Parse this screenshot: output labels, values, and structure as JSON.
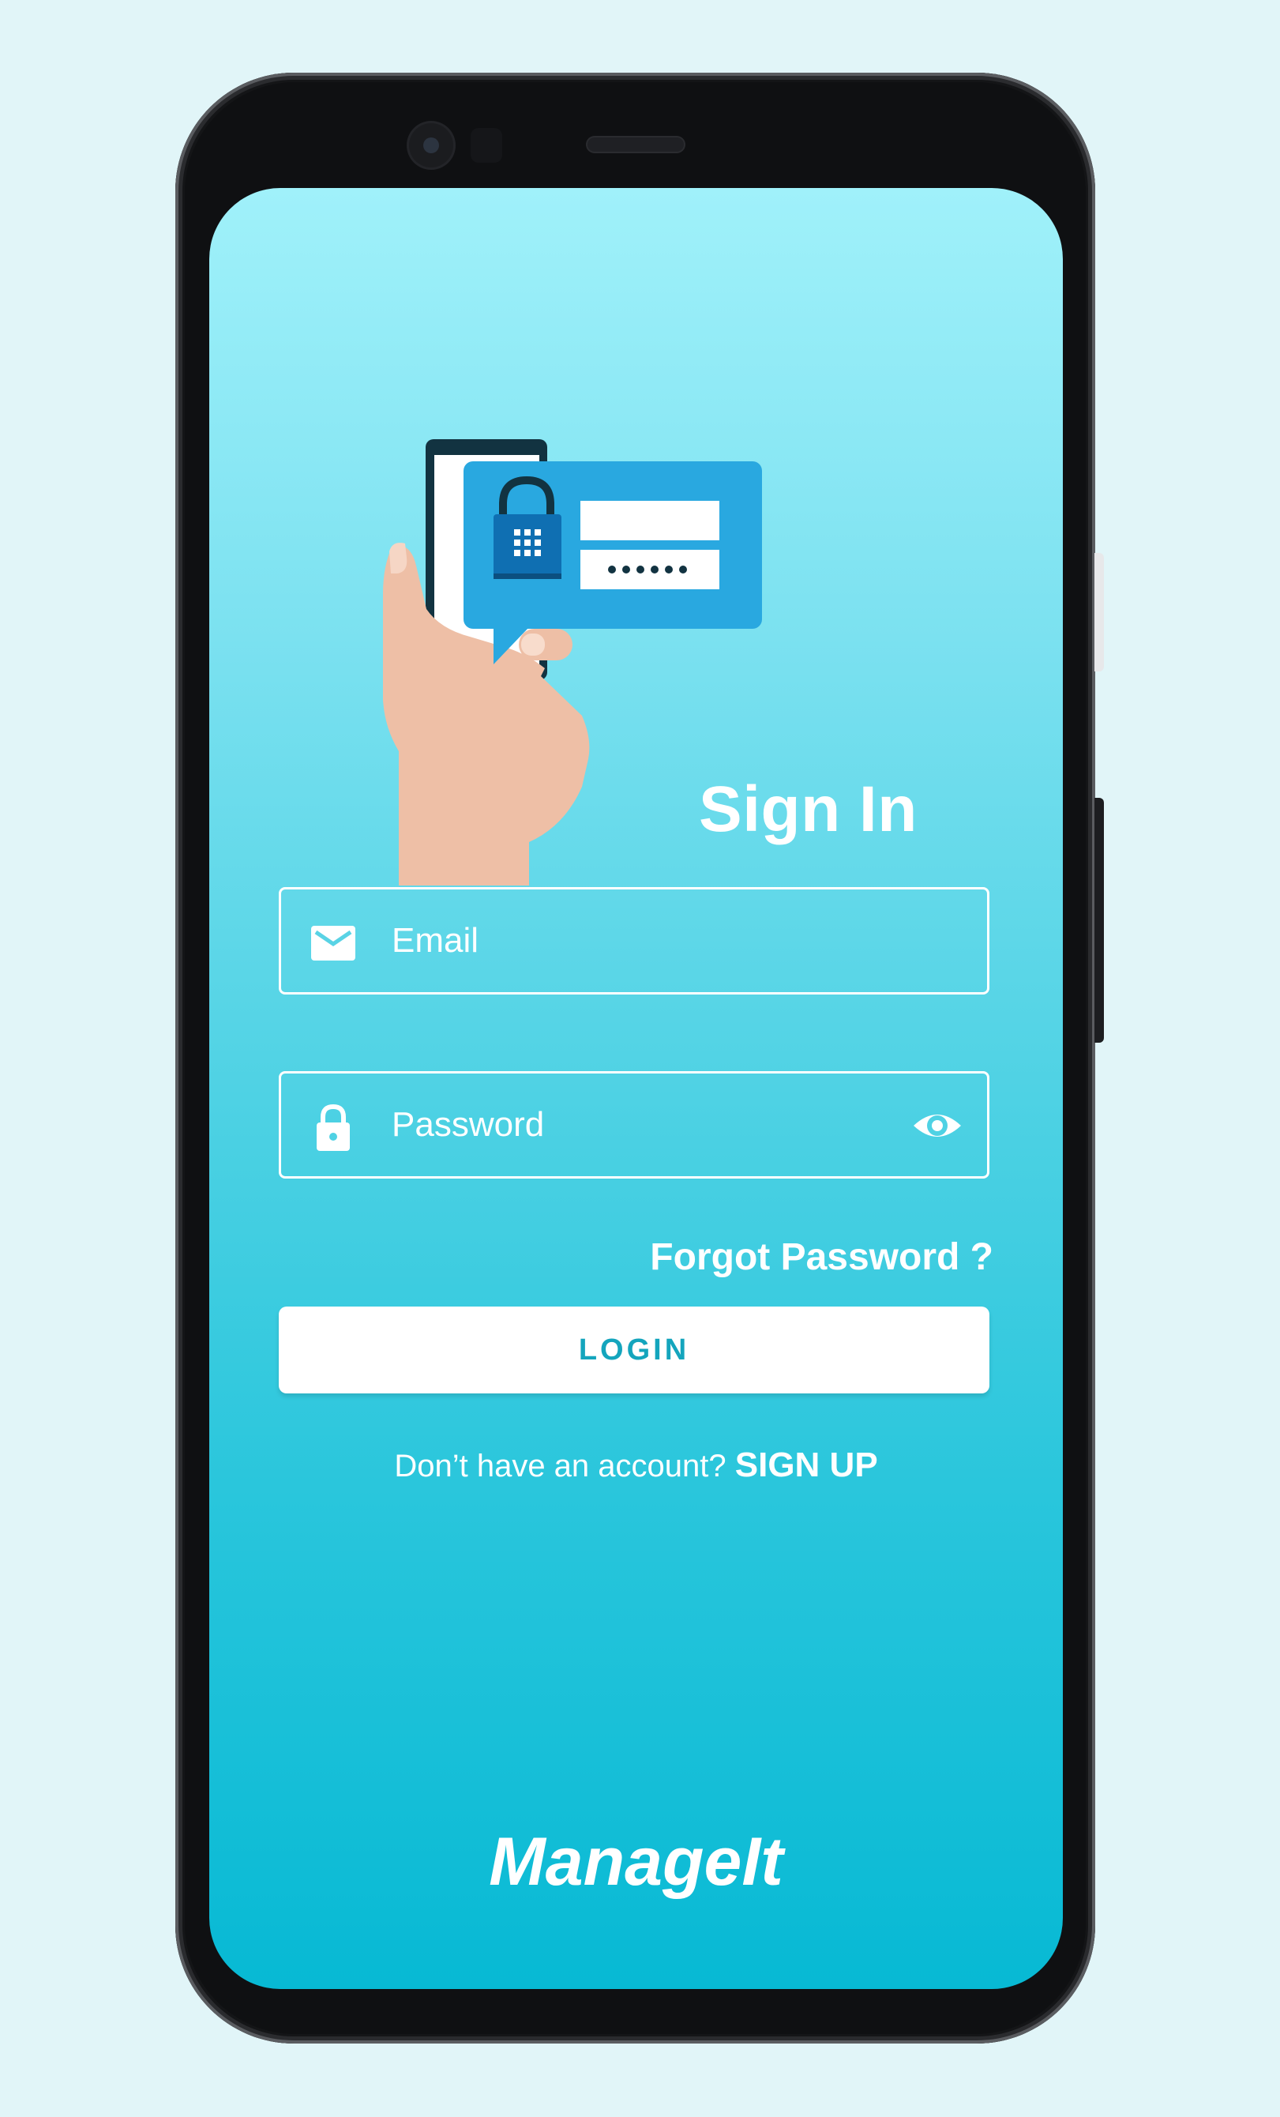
{
  "screen": {
    "title": "Sign In",
    "email": {
      "placeholder": "Email",
      "value": "",
      "icon": "mail-icon"
    },
    "password": {
      "placeholder": "Password",
      "value": "",
      "icon": "lock-icon",
      "toggle_icon": "eye-icon"
    },
    "forgot_password": "Forgot Password ?",
    "login_button": "LOGIN",
    "signup": {
      "prompt": "Don’t have an account?",
      "link": "SIGN UP"
    },
    "brand": "ManageIt"
  },
  "colors": {
    "gradient_top": "#a0f1fa",
    "gradient_bottom": "#07b9d4",
    "accent": "#14a5bd",
    "bubble": "#29a8e0",
    "background": "#e1f5f8"
  }
}
